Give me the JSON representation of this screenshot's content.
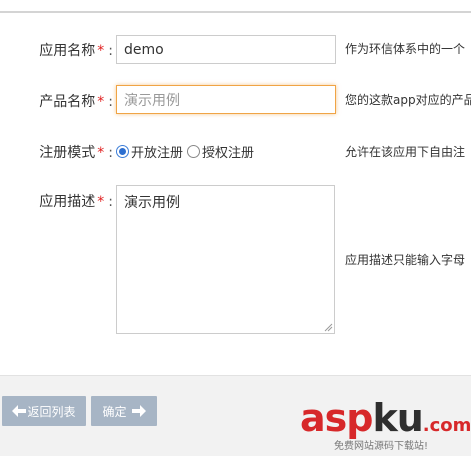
{
  "form": {
    "app_name": {
      "label": "应用名称",
      "required_mark": "*",
      "colon": ":",
      "value": "demo",
      "hint": "作为环信体系中的一个"
    },
    "product_name": {
      "label": "产品名称",
      "required_mark": "*",
      "colon": ":",
      "placeholder": "演示用例",
      "hint": "您的这款app对应的产品"
    },
    "register_mode": {
      "label": "注册模式",
      "required_mark": "*",
      "colon": ":",
      "options": [
        {
          "label": "开放注册",
          "checked": true
        },
        {
          "label": "授权注册",
          "checked": false
        }
      ],
      "hint": "允许在该应用下自由注"
    },
    "description": {
      "label": "应用描述",
      "required_mark": "*",
      "colon": ":",
      "value": "演示用例",
      "hint": "应用描述只能输入字母"
    }
  },
  "footer": {
    "back_button": "返回列表",
    "confirm_button": "确定"
  },
  "watermark": {
    "brand_a": "asp",
    "brand_b": "ku",
    "brand_suffix": ".com",
    "tagline": "免费网站源码下载站!"
  },
  "colors": {
    "required": "#e02020",
    "focus_border": "#f0a445",
    "radio_accent": "#2d6fd0",
    "button_bg": "#a7b5c5",
    "brand_red": "#d7282a"
  }
}
